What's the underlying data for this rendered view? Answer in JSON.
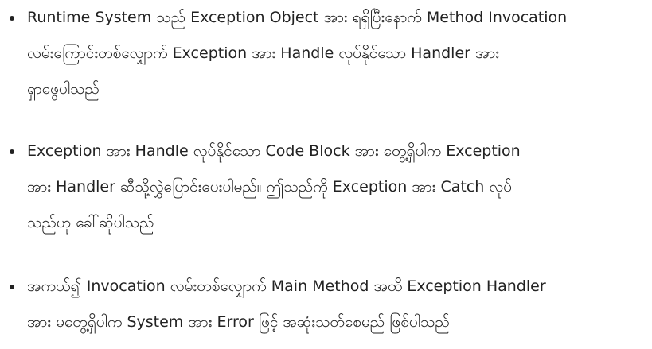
{
  "bullets": [
    {
      "lines": [
        "Runtime System သည် Exception Object အား ရရှိပြီးနောက် Method Invocation",
        "လမ်းကြောင်းတစ်လျှောက် Exception အား Handle လုပ်နိုင်သော Handler အား",
        "ရှာဖွေပါသည်"
      ]
    },
    {
      "lines": [
        "Exception အား Handle လုပ်နိုင်သော Code Block အား တွေ့ရှိပါက Exception",
        "အား Handler ဆီသို့လွှဲပြောင်းပေးပါမည်။ ဤသည်ကို Exception အား Catch လုပ်",
        "သည်ဟု ခေါ်ဆိုပါသည်"
      ]
    },
    {
      "lines": [
        "အကယ်၍ Invocation လမ်းတစ်လျှောက် Main Method အထိ Exception Handler",
        "အား မတွေ့ရှိပါက System အား Error ဖြင့် အဆုံးသတ်စေမည် ဖြစ်ပါသည်"
      ]
    }
  ]
}
